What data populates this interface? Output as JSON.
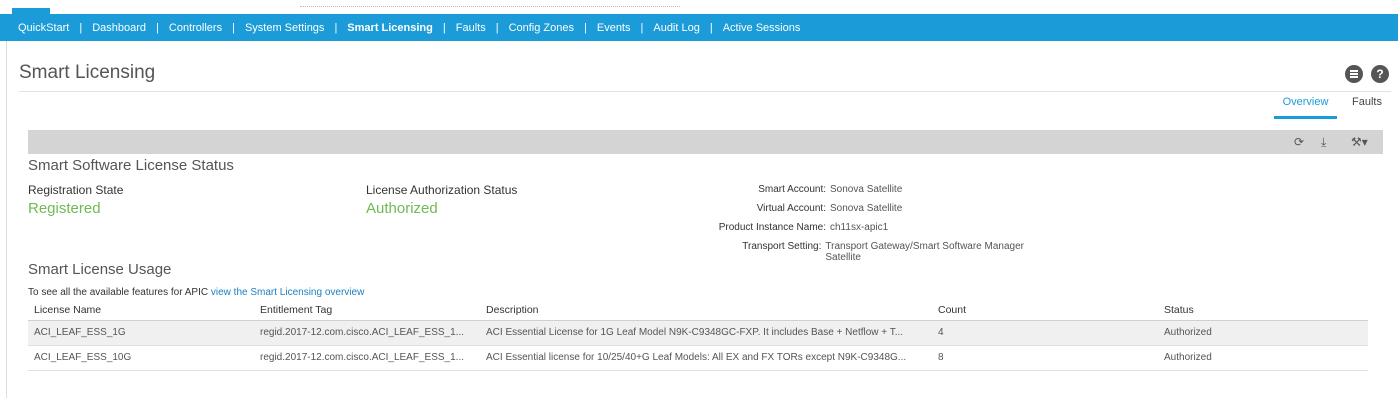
{
  "nav": {
    "items": [
      {
        "label": "QuickStart",
        "active": false
      },
      {
        "label": "Dashboard",
        "active": false
      },
      {
        "label": "Controllers",
        "active": false
      },
      {
        "label": "System Settings",
        "active": false
      },
      {
        "label": "Smart Licensing",
        "active": true
      },
      {
        "label": "Faults",
        "active": false
      },
      {
        "label": "Config Zones",
        "active": false
      },
      {
        "label": "Events",
        "active": false
      },
      {
        "label": "Audit Log",
        "active": false
      },
      {
        "label": "Active Sessions",
        "active": false
      }
    ],
    "separator": "|"
  },
  "page": {
    "title": "Smart Licensing",
    "help_glyph": "?",
    "tabs": {
      "overview": "Overview",
      "faults": "Faults"
    }
  },
  "toolbar": {
    "refresh_glyph": "⟳",
    "download_glyph": "⤓",
    "tools_glyph": "⚒▾"
  },
  "status": {
    "section_title": "Smart Software License Status",
    "registration_label": "Registration State",
    "registration_value": "Registered",
    "authorization_label": "License Authorization Status",
    "authorization_value": "Authorized",
    "smart_account_label": "Smart Account:",
    "smart_account_value": "Sonova Satellite",
    "virtual_account_label": "Virtual Account:",
    "virtual_account_value": "Sonova Satellite",
    "product_instance_label": "Product Instance Name:",
    "product_instance_value": "ch11sx-apic1",
    "transport_label": "Transport Setting:",
    "transport_value": "Transport Gateway/Smart Software Manager Satellite"
  },
  "usage": {
    "section_title": "Smart License Usage",
    "note_prefix": "To see all the available features for APIC ",
    "note_link": "view the Smart Licensing overview",
    "columns": {
      "name": "License Name",
      "tag": "Entitlement Tag",
      "description": "Description",
      "count": "Count",
      "status": "Status"
    },
    "rows": [
      {
        "name": "ACI_LEAF_ESS_1G",
        "tag": "regid.2017-12.com.cisco.ACI_LEAF_ESS_1...",
        "description": "ACI Essential License for 1G Leaf Model N9K-C9348GC-FXP. It includes Base + Netflow + T...",
        "count": "4",
        "status": "Authorized"
      },
      {
        "name": "ACI_LEAF_ESS_10G",
        "tag": "regid.2017-12.com.cisco.ACI_LEAF_ESS_1...",
        "description": "ACI Essential license for 10/25/40+G Leaf Models: All EX and FX TORs except N9K-C9348G...",
        "count": "8",
        "status": "Authorized"
      }
    ]
  },
  "colors": {
    "accent": "#1b9bd7",
    "success": "#6fba55",
    "toolbar_bg": "#d4d4d4"
  },
  "icons": {
    "list": "list-icon",
    "help": "help-icon",
    "refresh": "refresh-icon",
    "download": "download-icon",
    "tools": "tools-icon"
  }
}
